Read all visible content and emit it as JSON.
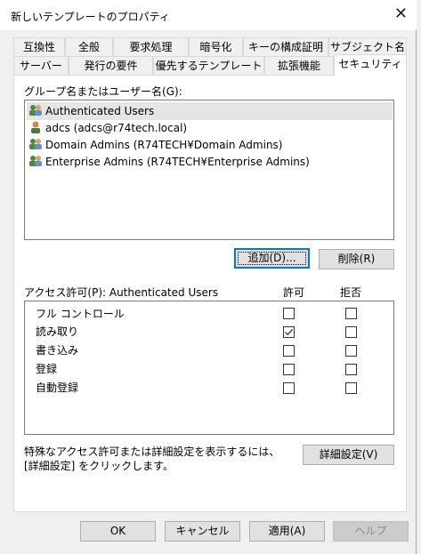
{
  "window": {
    "title": "新しいテンプレートのプロパティ",
    "close_glyph": "✕"
  },
  "tabs_back": [
    "互換性",
    "全般",
    "要求処理",
    "暗号化",
    "キーの構成証明",
    "サブジェクト名"
  ],
  "tabs_front": [
    "サーバー",
    "発行の要件",
    "優先するテンプレート",
    "拡張機能",
    "セキュリティ"
  ],
  "active_tab": "セキュリティ",
  "security": {
    "group_label": "グループ名またはユーザー名(G):",
    "principals": [
      {
        "name": "Authenticated Users",
        "icon": "group-icon",
        "selected": true
      },
      {
        "name": "adcs (adcs@r74tech.local)",
        "icon": "user-icon",
        "selected": false
      },
      {
        "name": "Domain Admins (R74TECH¥Domain Admins)",
        "icon": "group-icon",
        "selected": false
      },
      {
        "name": "Enterprise Admins (R74TECH¥Enterprise Admins)",
        "icon": "group-icon",
        "selected": false
      }
    ],
    "add_button": "追加(D)...",
    "remove_button": "削除(R)",
    "perm_label": "アクセス許可(P): Authenticated Users",
    "allow_header": "許可",
    "deny_header": "拒否",
    "permissions": [
      {
        "name": "フル コントロール",
        "allow": false,
        "deny": false
      },
      {
        "name": "読み取り",
        "allow": true,
        "deny": false
      },
      {
        "name": "書き込み",
        "allow": false,
        "deny": false
      },
      {
        "name": "登録",
        "allow": false,
        "deny": false
      },
      {
        "name": "自動登録",
        "allow": false,
        "deny": false
      }
    ],
    "advanced_note": "特殊なアクセス許可または詳細設定を表示するには、[詳細設定] をクリックします。",
    "advanced_button": "詳細設定(V)"
  },
  "footer": {
    "ok": "OK",
    "cancel": "キャンセル",
    "apply": "適用(A)",
    "help": "ヘルプ"
  },
  "colors": {
    "focus_border": "#0078d7",
    "selected_row": "#e5e5e5"
  }
}
